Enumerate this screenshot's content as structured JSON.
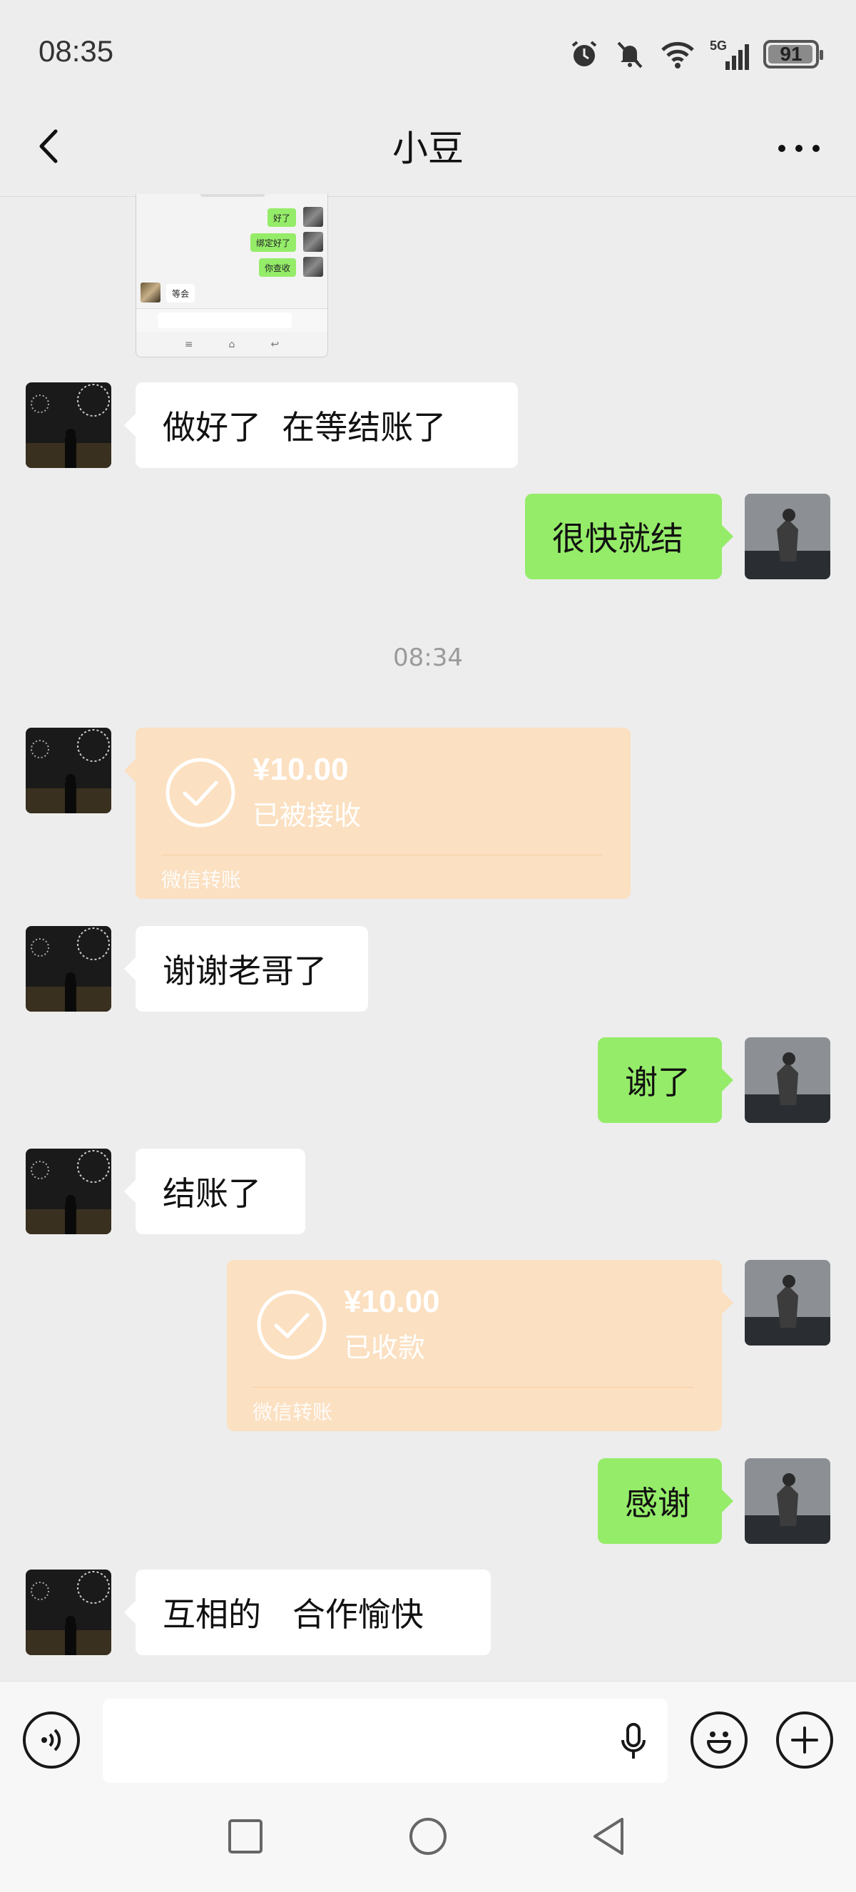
{
  "status_bar": {
    "time": "08:35",
    "network": "5G",
    "battery": "91",
    "battery_level_percent": 91,
    "icons": [
      "alarm-icon",
      "mute-bell-icon",
      "wifi-icon",
      "signal-icon",
      "battery-icon"
    ]
  },
  "header": {
    "title": "小豆",
    "back_icon": "chevron-left-icon",
    "more_icon": "ellipsis-icon"
  },
  "thumbnail": {
    "bubbles": [
      "好了",
      "绑定好了",
      "你查收",
      "等会"
    ]
  },
  "messages": [
    {
      "from": "contact",
      "text": "做好了  在等结账了"
    },
    {
      "from": "me",
      "text": "很快就结"
    },
    {
      "from": "contact",
      "type": "transfer",
      "amount": "¥10.00",
      "status": "已被接收",
      "footer": "微信转账"
    },
    {
      "from": "contact",
      "text": "谢谢老哥了"
    },
    {
      "from": "me",
      "text": "谢了"
    },
    {
      "from": "contact",
      "text": "结账了"
    },
    {
      "from": "me",
      "type": "transfer",
      "amount": "¥10.00",
      "status": "已收款",
      "footer": "微信转账"
    },
    {
      "from": "me",
      "text": "感谢"
    },
    {
      "from": "contact",
      "text": "互相的   合作愉快"
    }
  ],
  "timestamp": "08:34",
  "input_bar": {
    "voice_icon": "voice-icon",
    "mic_icon": "microphone-icon",
    "emoji_icon": "emoji-icon",
    "plus_icon": "plus-icon"
  },
  "colors": {
    "background": "#ededed",
    "my_bubble": "#95ec69",
    "contact_bubble": "#ffffff",
    "transfer_card": "#fbe0c1"
  }
}
